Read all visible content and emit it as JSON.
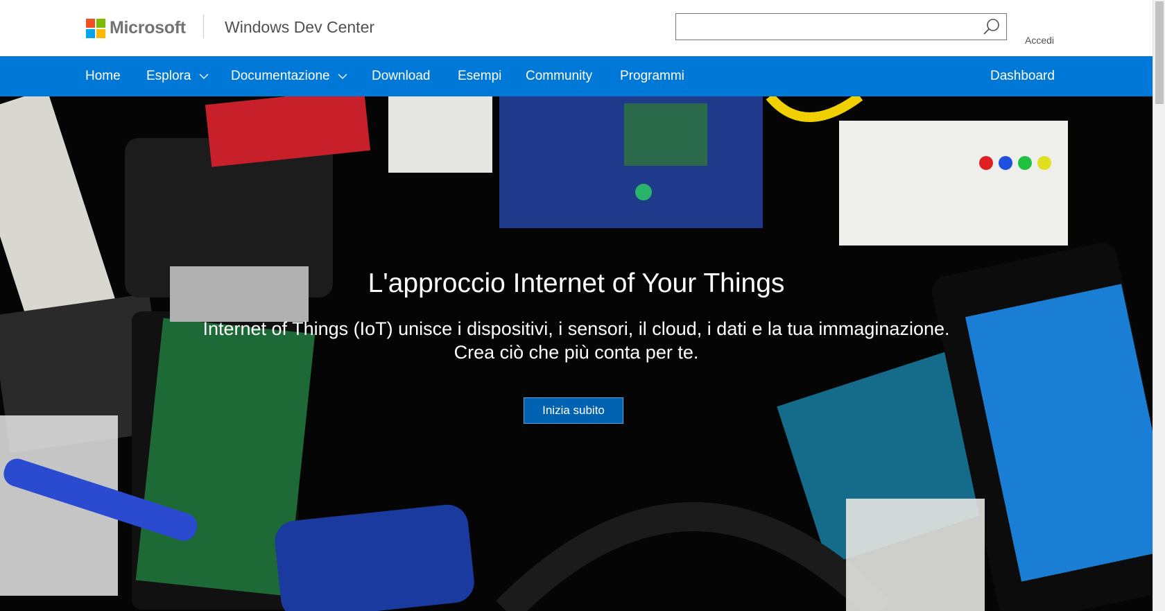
{
  "header": {
    "brand": "Microsoft",
    "site_title": "Windows Dev Center",
    "search": {
      "value": "",
      "placeholder": ""
    },
    "signin_label": "Accedi"
  },
  "nav": {
    "items": [
      {
        "label": "Home",
        "has_dropdown": false
      },
      {
        "label": "Esplora",
        "has_dropdown": true
      },
      {
        "label": "Documentazione",
        "has_dropdown": true
      },
      {
        "label": "Download",
        "has_dropdown": false
      },
      {
        "label": "Esempi",
        "has_dropdown": false
      },
      {
        "label": "Community",
        "has_dropdown": false
      },
      {
        "label": "Programmi",
        "has_dropdown": false
      }
    ],
    "right_item": "Dashboard"
  },
  "hero": {
    "title": "L'approccio Internet of Your Things",
    "subtitle_line1": "Internet of Things (IoT) unisce i dispositivi, i sensori, il cloud, i dati e la tua immaginazione.",
    "subtitle_line2": "Crea ciò che più conta per te.",
    "cta_label": "Inizia subito"
  },
  "colors": {
    "nav_bg": "#0078d7",
    "cta_bg": "#0062b0",
    "hero_bg": "#050505"
  },
  "icons": [
    "search-icon",
    "chevron-down-icon"
  ]
}
